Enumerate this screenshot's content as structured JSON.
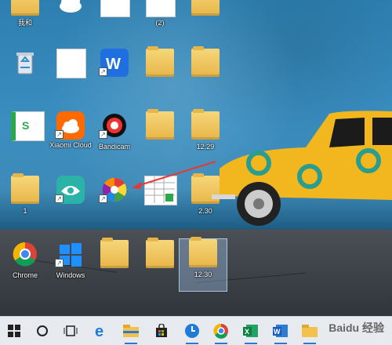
{
  "desktop": {
    "icons": [
      {
        "label": "我和",
        "type": "folder"
      },
      {
        "label": "",
        "type": "cloud"
      },
      {
        "label": "",
        "type": "doc"
      },
      {
        "label": "(2)",
        "type": "doc"
      },
      {
        "label": "",
        "type": "folder"
      },
      {
        "label": "",
        "type": "recycle-bin"
      },
      {
        "label": "",
        "type": "doc"
      },
      {
        "label": "",
        "type": "wps"
      },
      {
        "label": "",
        "type": "folder"
      },
      {
        "label": "",
        "type": "folder"
      },
      {
        "label": "",
        "type": "wps-sheet"
      },
      {
        "label": "Xiaomi Cloud",
        "type": "xiaomi-cloud"
      },
      {
        "label": "Bandicam",
        "type": "bandicam"
      },
      {
        "label": "",
        "type": "folder-image"
      },
      {
        "label": "12.29",
        "type": "folder"
      },
      {
        "label": "1",
        "type": "folder"
      },
      {
        "label": "",
        "type": "eye-app"
      },
      {
        "label": "",
        "type": "color-wheel"
      },
      {
        "label": "",
        "type": "spreadsheet"
      },
      {
        "label": "2.30",
        "type": "folder"
      },
      {
        "label": "Chrome",
        "type": "chrome"
      },
      {
        "label": "Windows",
        "type": "windows"
      },
      {
        "label": "",
        "type": "folder"
      },
      {
        "label": "",
        "type": "folder-image"
      },
      {
        "label": "12.30",
        "type": "folder"
      }
    ]
  },
  "taskbar": {
    "items": [
      "start",
      "search",
      "task-view",
      "edge",
      "file-explorer",
      "store",
      "clock",
      "chrome",
      "excel",
      "word",
      "folder"
    ],
    "watermark": "Baidu 经验"
  }
}
